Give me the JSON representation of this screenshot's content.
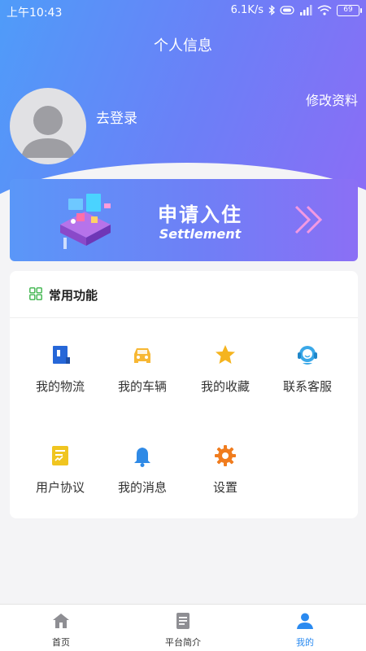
{
  "status_bar": {
    "time": "上午10:43",
    "speed": "6.1K/s",
    "battery": "69"
  },
  "header": {
    "title": "个人信息",
    "edit_label": "修改资料",
    "login_label": "去登录"
  },
  "banner": {
    "title": "申请入住",
    "subtitle": "Settlement"
  },
  "common_functions": {
    "title": "常用功能",
    "items": [
      {
        "label": "我的物流",
        "icon": "logistics-icon",
        "color": "#2667d8"
      },
      {
        "label": "我的车辆",
        "icon": "car-icon",
        "color": "#f7b733"
      },
      {
        "label": "我的收藏",
        "icon": "star-icon",
        "color": "#f5b41f"
      },
      {
        "label": "联系客服",
        "icon": "headset-icon",
        "color": "#3aa8e8"
      },
      {
        "label": "用户协议",
        "icon": "agreement-icon",
        "color": "#f0c520"
      },
      {
        "label": "我的消息",
        "icon": "bell-icon",
        "color": "#2f8ae6"
      },
      {
        "label": "设置",
        "icon": "gear-icon",
        "color": "#f07c1e"
      }
    ]
  },
  "tabbar": {
    "items": [
      {
        "label": "首页",
        "icon": "home-icon"
      },
      {
        "label": "平台简介",
        "icon": "document-icon"
      },
      {
        "label": "我的",
        "icon": "user-icon",
        "active": true
      }
    ]
  },
  "colors": {
    "accent": "#2a8af0",
    "header_gradient_start": "#4f9cf9",
    "header_gradient_end": "#8a6df6"
  }
}
